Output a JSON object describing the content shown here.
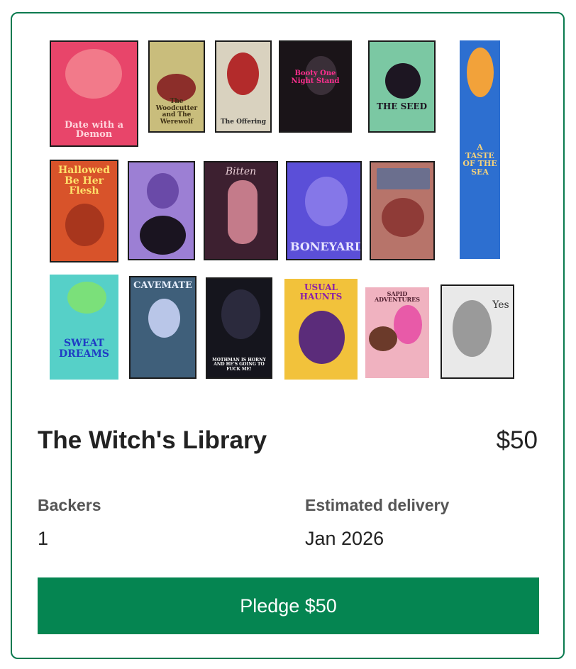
{
  "reward": {
    "title": "The Witch's Library",
    "price": "$50",
    "backers_label": "Backers",
    "backers_value": "1",
    "delivery_label": "Estimated delivery",
    "delivery_value": "Jan 2026",
    "pledge_label": "Pledge $50"
  },
  "covers": {
    "date_with_a_demon": "Date with a Demon",
    "woodcutter": "The Woodcutter and The Werewolf",
    "offering": "The Offering",
    "booty_one_night_stand": "Booty One Night Stand",
    "the_seed": "THE SEED",
    "taste_of_the_sea": "A TASTE OF THE SEA",
    "hallowed": "Hallowed Be Her Flesh",
    "crystal_ball": "",
    "bitten": "Bitten",
    "boneyard": "BONEYARD",
    "panels": "",
    "sweat_dreams": "SWEAT DREAMS",
    "cavemate": "CAVEMATE",
    "mothman": "MOTHMAN IS HORNY AND HE'S GOING TO FUCK ME!",
    "usual_haunts": "USUAL HAUNTS",
    "sapid_adventures": "SAPID ADVENTURES",
    "yes": "Yes"
  },
  "colors": {
    "accent": "#058551",
    "border": "#0a7a4f"
  }
}
